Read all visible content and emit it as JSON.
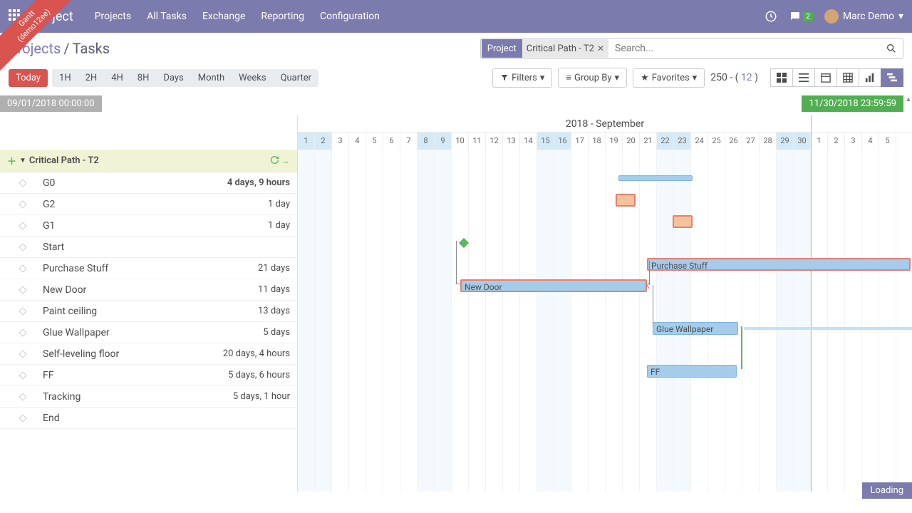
{
  "ribbon": {
    "line1": "Gantt",
    "line2": "(demo12ee)"
  },
  "nav": {
    "brand": "Project",
    "menu": [
      "Projects",
      "All Tasks",
      "Exchange",
      "Reporting",
      "Configuration"
    ],
    "chat_badge": "2",
    "user": "Marc Demo"
  },
  "breadcrumb": {
    "root": "Projects",
    "current": "Tasks"
  },
  "search": {
    "facet_key": "Project",
    "facet_value": "Critical Path - T2",
    "placeholder": "Search..."
  },
  "zoom": {
    "today": "Today",
    "levels": [
      "1H",
      "2H",
      "4H",
      "8H",
      "Days",
      "Month",
      "Weeks",
      "Quarter"
    ]
  },
  "filters": {
    "filters": "Filters",
    "groupby": "Group By",
    "favorites": "Favorites"
  },
  "pager": {
    "prefix": "250 - ( ",
    "count": "12",
    "suffix": " )"
  },
  "range": {
    "start": "09/01/2018 00:00:00",
    "end": "11/30/2018 23:59:59"
  },
  "timeline": {
    "month": "2018 - September",
    "days": [
      1,
      2,
      3,
      4,
      5,
      6,
      7,
      8,
      9,
      10,
      11,
      12,
      13,
      14,
      15,
      16,
      17,
      18,
      19,
      20,
      21,
      22,
      23,
      24,
      25,
      26,
      27,
      28,
      29,
      30,
      1,
      2,
      3,
      4,
      5
    ],
    "weekends": [
      0,
      1,
      7,
      8,
      14,
      15,
      21,
      22,
      28,
      29
    ]
  },
  "group": {
    "name": "Critical Path - T2"
  },
  "tasks": [
    {
      "name": "G0",
      "duration": "4 days, 9 hours",
      "bold": true
    },
    {
      "name": "G2",
      "duration": "1 day"
    },
    {
      "name": "G1",
      "duration": "1 day"
    },
    {
      "name": "Start",
      "duration": ""
    },
    {
      "name": "Purchase Stuff",
      "duration": "21 days"
    },
    {
      "name": "New Door",
      "duration": "11 days"
    },
    {
      "name": "Paint ceiling",
      "duration": "13 days"
    },
    {
      "name": "Glue Wallpaper",
      "duration": "5 days"
    },
    {
      "name": "Self-leveling floor",
      "duration": "20 days, 4 hours"
    },
    {
      "name": "FF",
      "duration": "5 days, 6 hours"
    },
    {
      "name": "Tracking",
      "duration": "5 days, 1 hour"
    },
    {
      "name": "End",
      "duration": ""
    }
  ],
  "bars": {
    "purchase": "Purchase Stuff",
    "newdoor": "New Door",
    "glue": "Glue Wallpaper",
    "ff": "FF"
  },
  "loading": "Loading"
}
